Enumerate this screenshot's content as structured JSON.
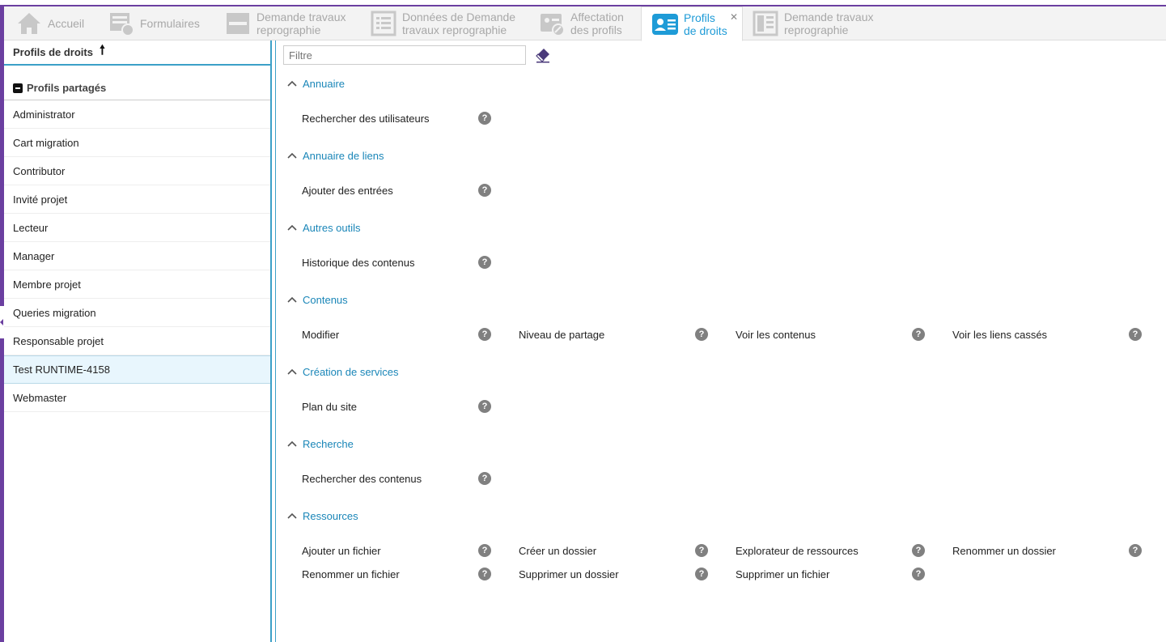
{
  "tabs": [
    {
      "label": "Accueil",
      "icon": "home-icon"
    },
    {
      "label": "Formulaires",
      "icon": "forms-icon"
    },
    {
      "label": "Demande travaux\nreprographie",
      "icon": "form-icon"
    },
    {
      "label": "Données de Demande\ntravaux reprographie",
      "icon": "list-icon"
    },
    {
      "label": "Affectation\ndes profils",
      "icon": "assign-profile-icon"
    },
    {
      "label": "Profils\nde droits",
      "icon": "profile-card-icon",
      "active": true
    },
    {
      "label": "Demande travaux\nreprographie",
      "icon": "document-icon"
    }
  ],
  "sidebar": {
    "title": "Profils de droits",
    "group": "Profils partagés",
    "profiles": [
      "Administrator",
      "Cart migration",
      "Contributor",
      "Invité projet",
      "Lecteur",
      "Manager",
      "Membre projet",
      "Queries migration",
      "Responsable projet",
      "Test RUNTIME-4158",
      "Webmaster"
    ],
    "selected": "Test RUNTIME-4158"
  },
  "filter": {
    "placeholder": "Filtre"
  },
  "sections": [
    {
      "title": "Annuaire",
      "items": [
        "Rechercher des utilisateurs"
      ]
    },
    {
      "title": "Annuaire de liens",
      "items": [
        "Ajouter des entrées"
      ]
    },
    {
      "title": "Autres outils",
      "items": [
        "Historique des contenus"
      ]
    },
    {
      "title": "Contenus",
      "items": [
        "Modifier",
        "Niveau de partage",
        "Voir les contenus",
        "Voir les liens cassés"
      ]
    },
    {
      "title": "Création de services",
      "items": [
        "Plan du site"
      ]
    },
    {
      "title": "Recherche",
      "items": [
        "Rechercher des contenus"
      ]
    },
    {
      "title": "Ressources",
      "items": [
        "Ajouter un fichier",
        "Créer un dossier",
        "Explorateur de ressources",
        "Renommer un dossier",
        "Renommer un fichier",
        "Supprimer un dossier",
        "Supprimer un fichier"
      ]
    }
  ],
  "colors": {
    "accent": "#1a86b8",
    "border_accent": "#3ca0c8",
    "frame": "#6b3fa0",
    "tab_active": "#1e9bd7"
  }
}
